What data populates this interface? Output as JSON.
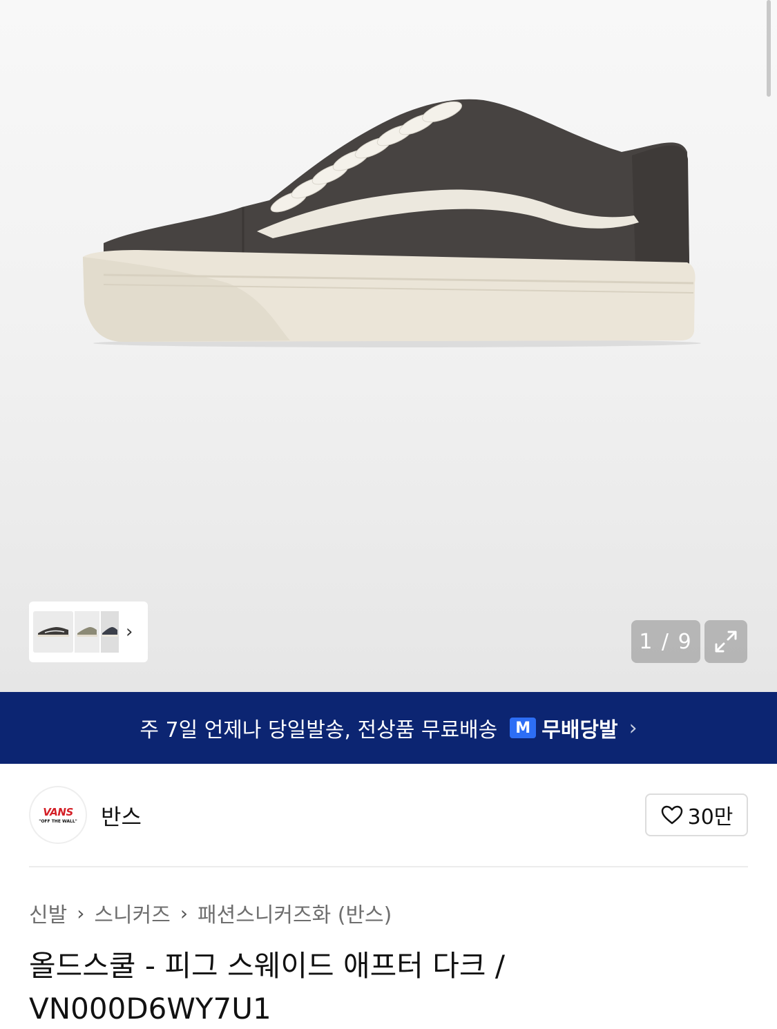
{
  "gallery": {
    "counter": "1 / 9",
    "thumbnails": [
      "product-thumb-1",
      "product-thumb-2",
      "product-thumb-3"
    ]
  },
  "banner": {
    "text": "주 7일 언제나 당일발송, 전상품 무료배송",
    "badge_logo": "M",
    "badge_text": "무배당발"
  },
  "brand": {
    "logo_text": "VANS",
    "logo_subtext": "\"OFF THE WALL\"",
    "name": "반스",
    "likes": "30만"
  },
  "breadcrumb": {
    "items": [
      "신발",
      "스니커즈",
      "패션스니커즈화 (반스)"
    ]
  },
  "product": {
    "title": "올드스쿨 - 피그 스웨이드 애프터 다크 / VN000D6WY7U1"
  },
  "colors": {
    "banner_bg": "#0c2572",
    "badge_blue": "#2d6ef5",
    "brand_red": "#d42027"
  }
}
